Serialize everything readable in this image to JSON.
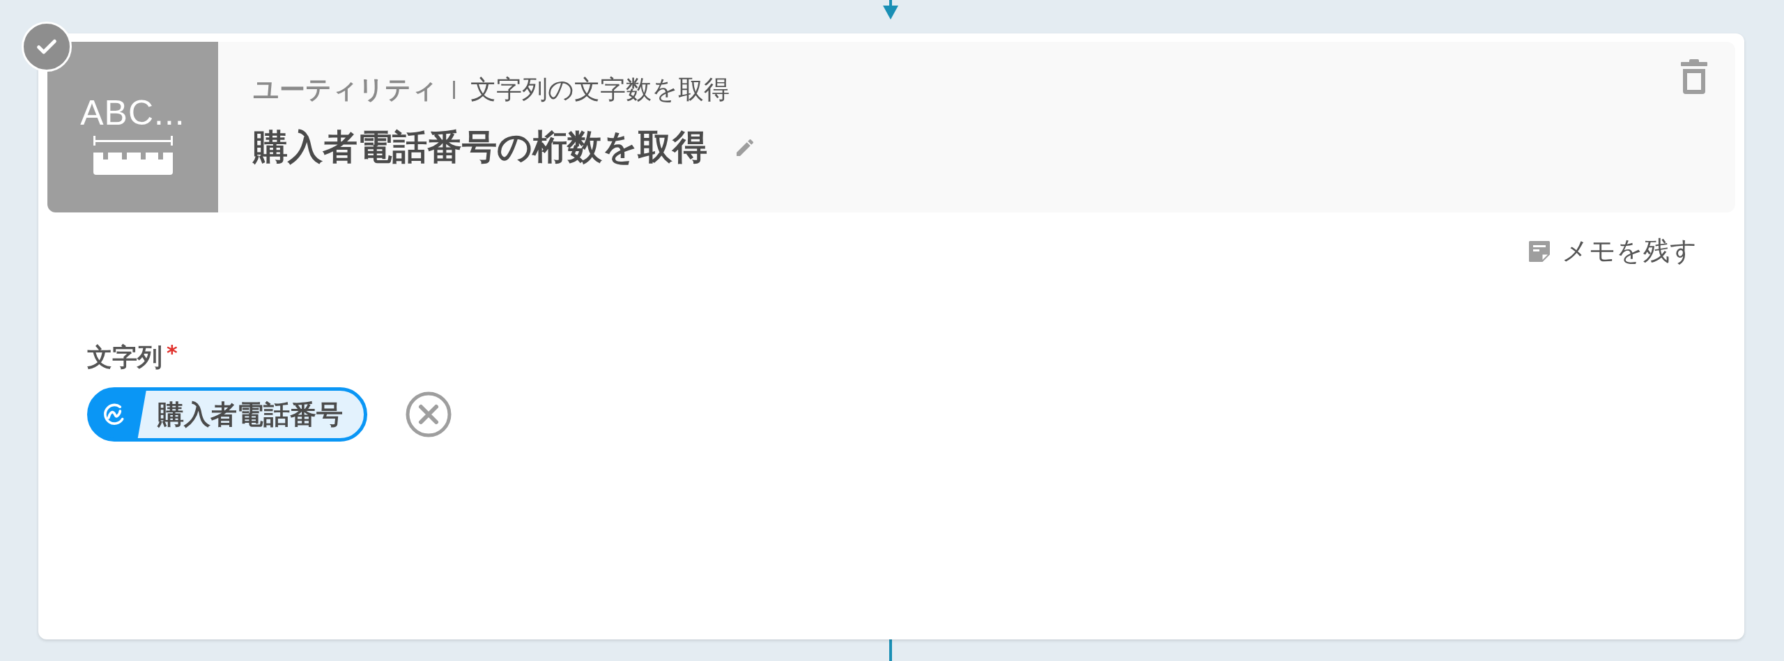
{
  "card": {
    "completed": true,
    "tile_text": "ABC...",
    "category": "ユーティリティ",
    "action": "文字列の文字数を取得",
    "title": "購入者電話番号の桁数を取得",
    "memo_button": "メモを残す",
    "fields": [
      {
        "label": "文字列",
        "required_mark": "*",
        "value": "購入者電話番号"
      }
    ]
  }
}
